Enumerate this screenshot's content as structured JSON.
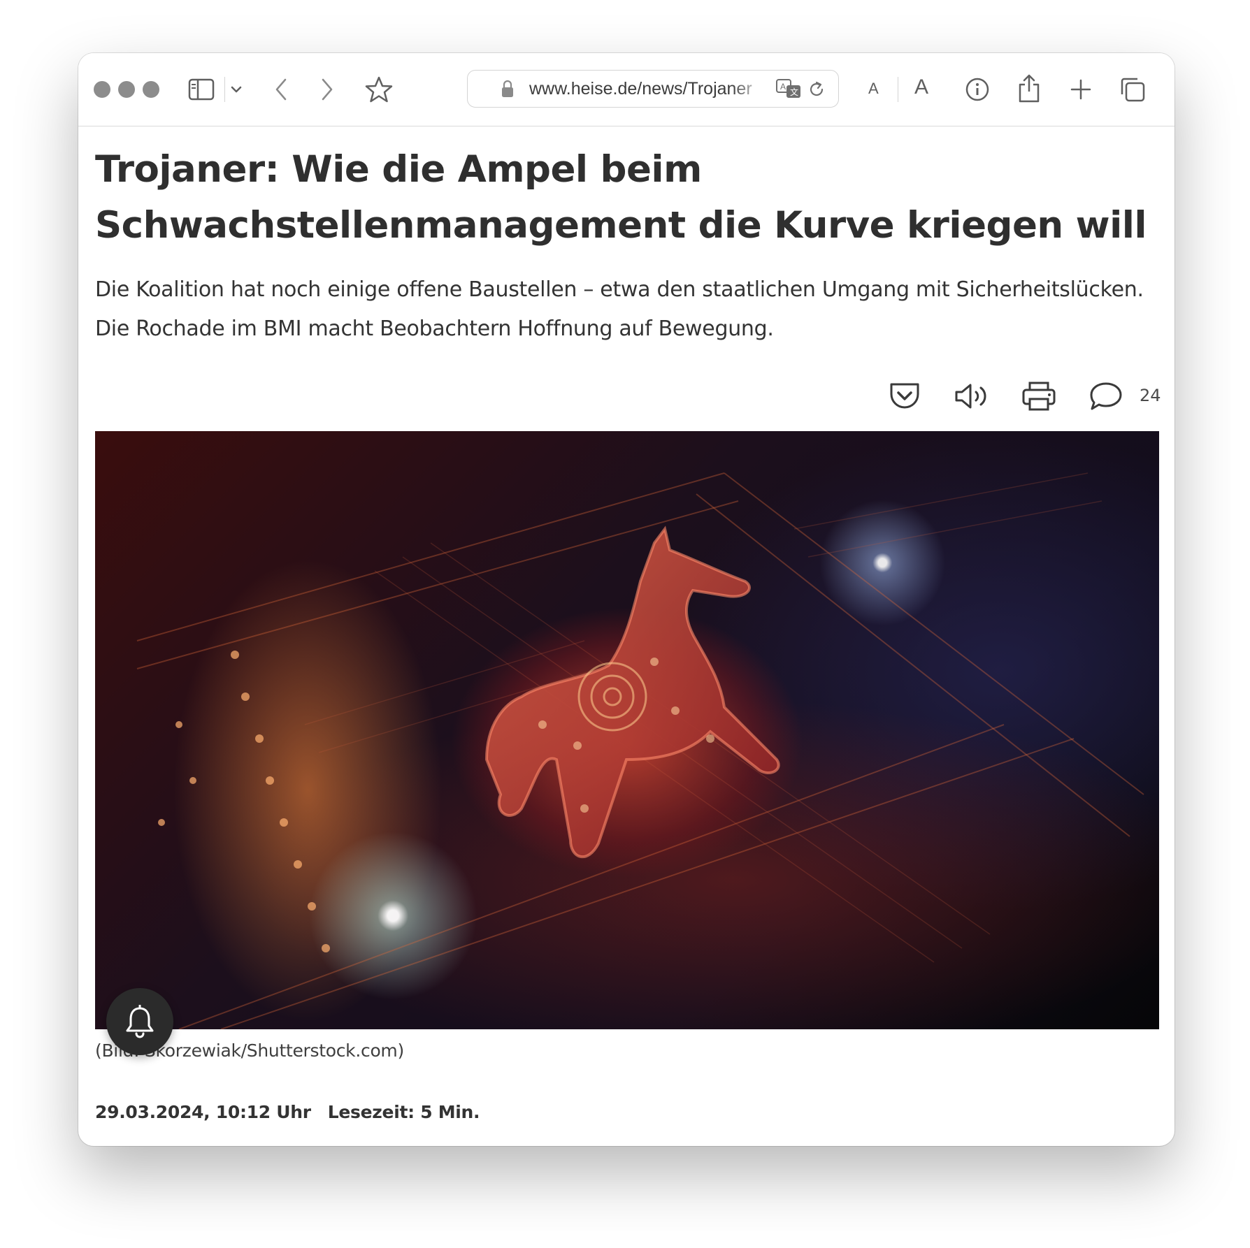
{
  "browser": {
    "url": "www.heise.de/news/Trojaner",
    "font_small_label": "A",
    "font_large_label": "A",
    "icons": [
      "sidebar-icon",
      "chevron-down-icon",
      "back-icon",
      "forward-icon",
      "star-icon",
      "lock-icon",
      "translate-icon",
      "reload-icon",
      "info-icon",
      "share-icon",
      "plus-icon",
      "tabs-icon"
    ]
  },
  "article": {
    "headline": "Trojaner: Wie die Ampel beim Schwachstellenmanagement die Kurve kriegen will",
    "lead": "Die Koalition hat noch einige offene Baustellen – etwa den staatlichen Umgang mit Sicherheitslücken. Die Rochade im BMI macht Beobachtern Hoffnung auf Bewegung.",
    "comment_count": "24",
    "image_caption": "(Bild: Skorzewiak/Shutterstock.com)",
    "date": "29.03.2024, 10:12 Uhr",
    "reading_time": "Lesezeit: 5 Min.",
    "action_icons": [
      "pocket-icon",
      "speaker-icon",
      "print-icon",
      "comment-icon",
      "bell-icon"
    ]
  },
  "colors": {
    "text": "#2f2f2f",
    "traffic_light": "#8c8c8c",
    "bell_button": "#2b2b2b"
  }
}
